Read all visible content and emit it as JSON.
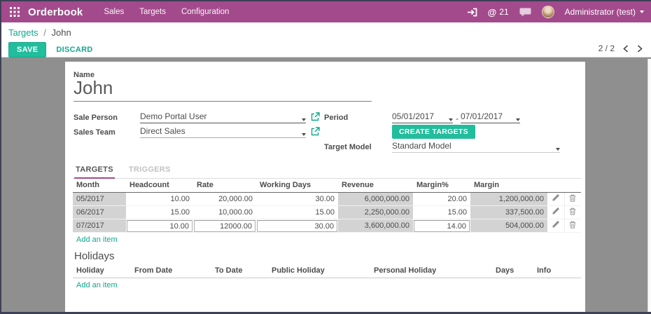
{
  "colors": {
    "topbar_bg": "#a34a8c",
    "accent_link": "#12a88f",
    "button_green": "#21bd9c",
    "tab_underline": "#a34a8c",
    "readonly_cell_bg": "#d3d3d3",
    "content_bg": "#8f8f8f"
  },
  "topbar": {
    "app_name": "Orderbook",
    "menus": [
      "Sales",
      "Targets",
      "Configuration"
    ],
    "right": {
      "at_symbol": "@",
      "at_count": "21",
      "user_name": "Administrator (test)"
    }
  },
  "breadcrumb": {
    "parent": "Targets",
    "separator": "/",
    "current": "John"
  },
  "control_panel": {
    "save_label": "SAVE",
    "discard_label": "DISCARD",
    "pager": "2 / 2"
  },
  "form": {
    "name_label": "Name",
    "name_value": "John",
    "sale_person_label": "Sale Person",
    "sale_person_value": "Demo Portal User",
    "sales_team_label": "Sales Team",
    "sales_team_value": "Direct Sales",
    "period_label": "Period",
    "period_from": "05/01/2017",
    "period_separator": "-",
    "period_to": "07/01/2017",
    "create_targets_label": "CREATE TARGETS",
    "target_model_label": "Target Model",
    "target_model_value": "Standard Model"
  },
  "tabs": {
    "targets": "TARGETS",
    "triggers": "TRIGGERS"
  },
  "targets_table": {
    "columns": [
      "Month",
      "Headcount",
      "Rate",
      "Working Days",
      "Revenue",
      "Margin%",
      "Margin"
    ],
    "rows": [
      {
        "month": "05/2017",
        "headcount": "10.00",
        "rate": "20,000.00",
        "working_days": "30.00",
        "revenue": "6,000,000.00",
        "margin_pct": "20.00",
        "margin": "1,200,000.00"
      },
      {
        "month": "06/2017",
        "headcount": "15.00",
        "rate": "10,000.00",
        "working_days": "15.00",
        "revenue": "2,250,000.00",
        "margin_pct": "15.00",
        "margin": "337,500.00"
      },
      {
        "month": "07/2017",
        "headcount": "10.00",
        "rate": "12000.00",
        "working_days": "30.00",
        "revenue": "3,600,000.00",
        "margin_pct": "14.00",
        "margin": "504,000.00"
      }
    ],
    "add_item_label": "Add an item"
  },
  "holidays": {
    "title": "Holidays",
    "columns": [
      "Holiday",
      "From Date",
      "To Date",
      "Public Holiday",
      "Personal Holiday",
      "Days",
      "Info"
    ],
    "add_item_label": "Add an item"
  }
}
